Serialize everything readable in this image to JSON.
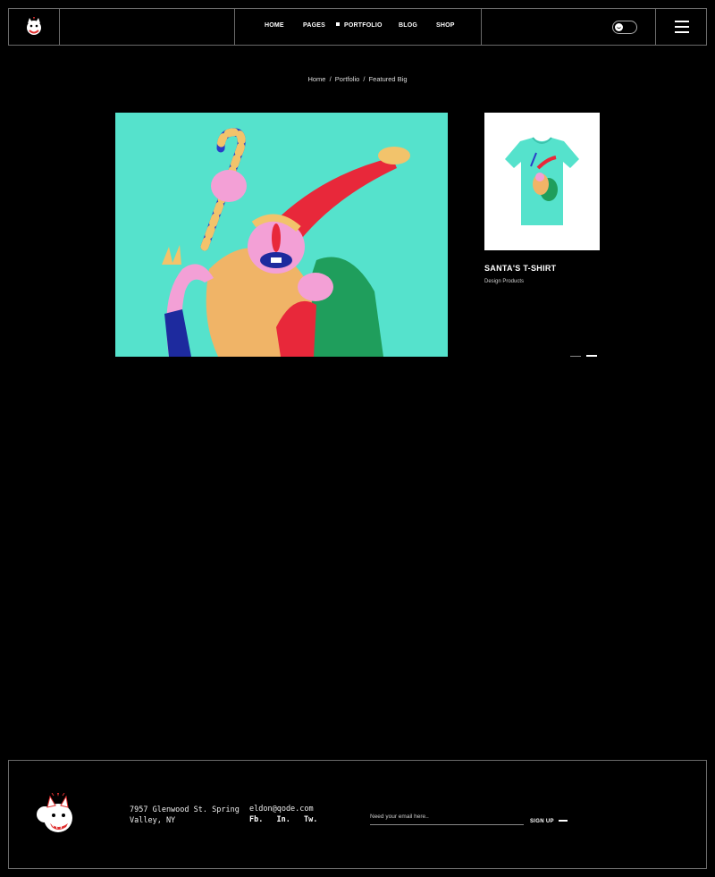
{
  "nav": {
    "items": [
      {
        "label": "HOME",
        "active": false
      },
      {
        "label": "PAGES",
        "active": false
      },
      {
        "label": "PORTFOLIO",
        "active": true
      },
      {
        "label": "BLOG",
        "active": false
      },
      {
        "label": "SHOP",
        "active": false
      }
    ]
  },
  "icons": {
    "logo": "fox-mascot-logo-icon",
    "toggle": "dark-mode-toggle-icon",
    "menu": "hamburger-menu-icon"
  },
  "breadcrumb": {
    "home": "Home",
    "portfolio": "Portfolio",
    "current": "Featured Big",
    "separator": "/"
  },
  "feature": {
    "background_color": "#55e2cc"
  },
  "card": {
    "title": "SANTA'S T-SHIRT",
    "category": "Design Products"
  },
  "footer": {
    "address": "7957 Glenwood St. Spring Valley, NY",
    "email": "eldon@qode.com",
    "socials": [
      "Fb.",
      "In.",
      "Tw."
    ],
    "newsletter_placeholder": "Need your email here..",
    "signup_label": "SIGN UP"
  }
}
